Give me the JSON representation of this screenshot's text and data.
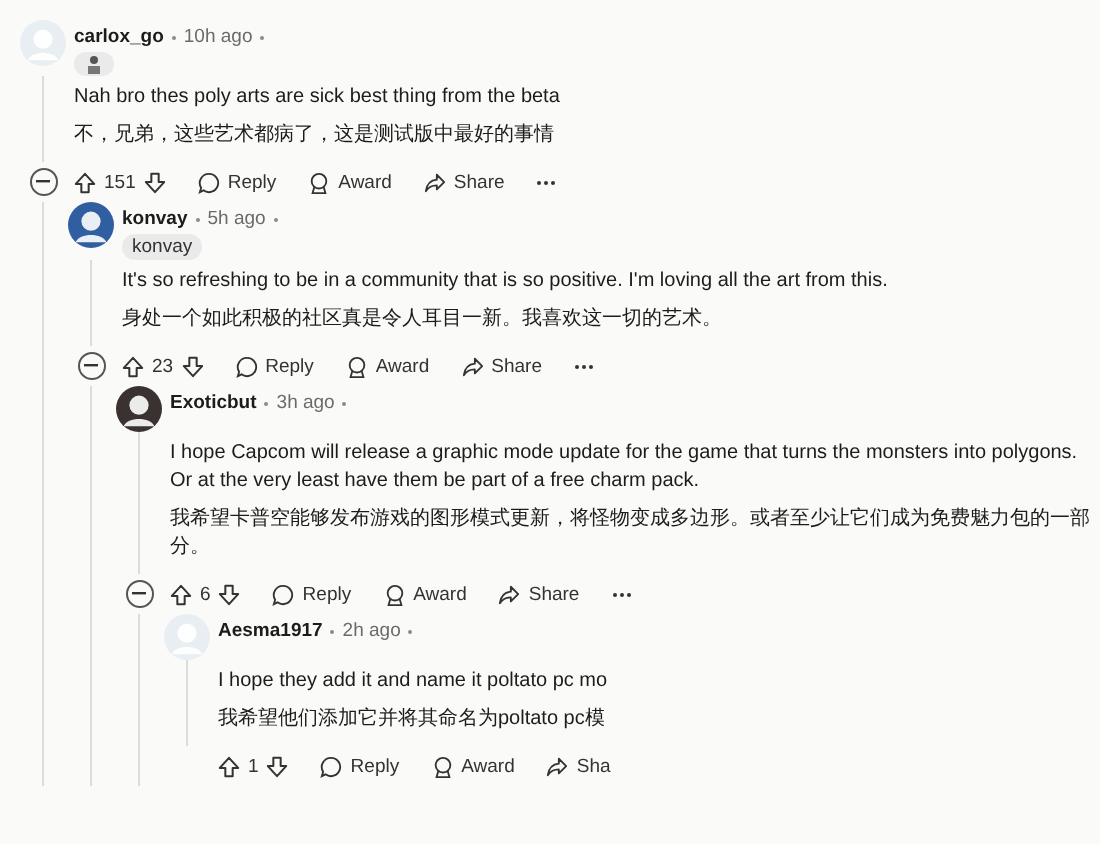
{
  "comments": [
    {
      "user": "carlox_go",
      "time": "10h ago",
      "color": "#e8eef2",
      "flair": {
        "kind": "icon"
      },
      "lines": [
        "Nah bro thes poly arts are sick best thing from the beta",
        "不，兄弟，这些艺术都病了，这是测试版中最好的事情"
      ],
      "collapse_button": true,
      "score": "151",
      "actions": [
        "Reply",
        "Award",
        "Share"
      ],
      "more_button": true,
      "children": [
        {
          "user": "konvay",
          "time": "5h ago",
          "color": "#2f5fa0",
          "flair": {
            "kind": "text",
            "text": "konvay"
          },
          "lines": [
            "It's so refreshing to be in a community that is so positive. I'm loving all the art from this.",
            "身处一个如此积极的社区真是令人耳目一新。我喜欢这一切的艺术。"
          ],
          "collapse_button": true,
          "score": "23",
          "actions": [
            "Reply",
            "Award",
            "Share"
          ],
          "more_button": true,
          "children": [
            {
              "user": "Exoticbut",
              "time": "3h ago",
              "color": "#3a3230",
              "lines": [
                "I hope Capcom will release a graphic mode update for the game that turns the monsters into polygons. Or at the very least have them be part of a free charm pack.",
                "我希望卡普空能够发布游戏的图形模式更新，将怪物变成多边形。或者至少让它们成为免费魅力包的一部分。"
              ],
              "collapse_button": true,
              "score": "6",
              "actions": [
                "Reply",
                "Award",
                "Share"
              ],
              "more_button": true,
              "children": [
                {
                  "user": "Aesma1917",
                  "time": "2h ago",
                  "color": "#e8eef2",
                  "lines": [
                    "I hope they add it and name it poltato pc mo",
                    "我希望他们添加它并将其命名为poltato pc模"
                  ],
                  "collapse_button": false,
                  "score": "1",
                  "actions": [
                    "Reply",
                    "Award",
                    "Sha"
                  ],
                  "more_button": false
                }
              ]
            }
          ]
        }
      ]
    }
  ]
}
